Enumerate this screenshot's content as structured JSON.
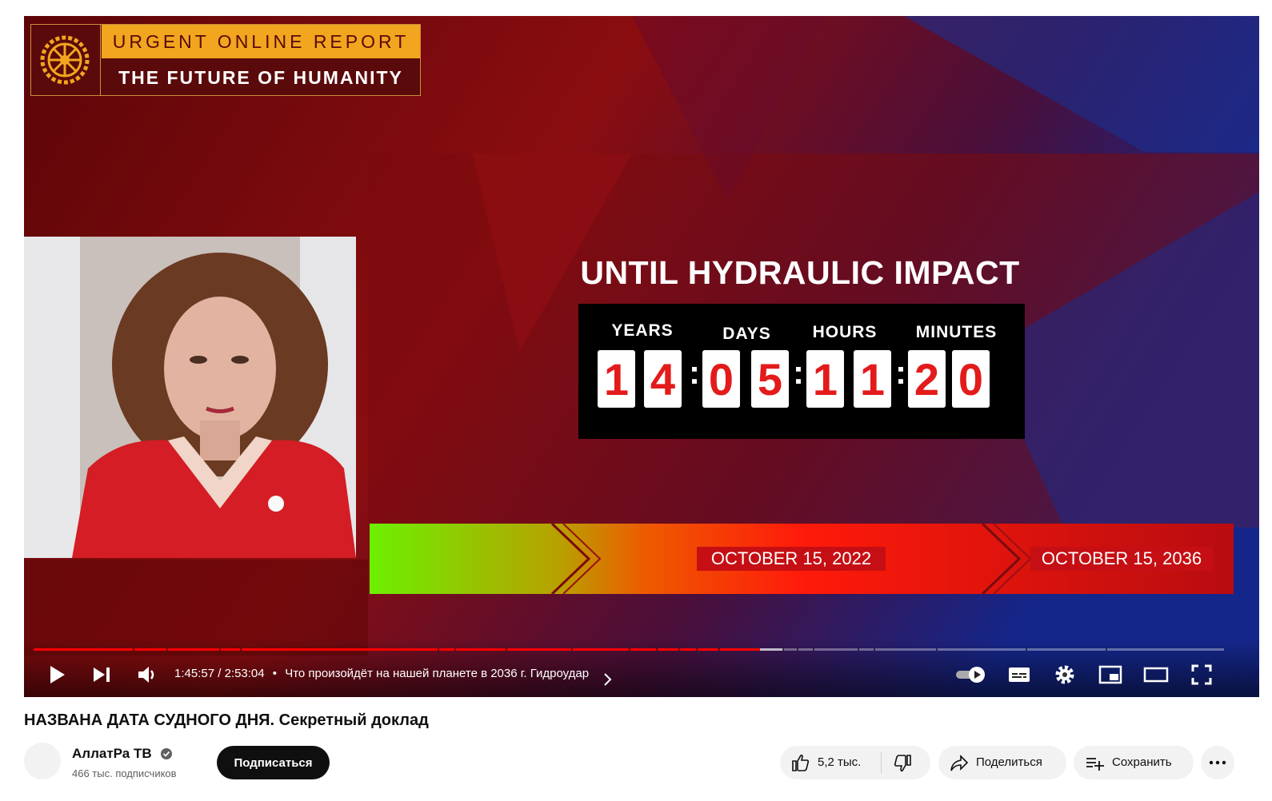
{
  "video": {
    "badge_top": "URGENT ONLINE REPORT",
    "badge_bottom": "THE FUTURE OF HUMANITY",
    "headline": "UNTIL HYDRAULIC IMPACT",
    "countdown": {
      "labels": {
        "years": "YEARS",
        "days": "DAYS",
        "hours": "HOURS",
        "minutes": "MINUTES"
      },
      "digits": [
        "1",
        "4",
        "0",
        "5",
        "1",
        "1",
        "2",
        "0"
      ]
    },
    "timeline": {
      "start_date": "OCTOBER 15, 2022",
      "end_date": "OCTOBER 15, 2036"
    },
    "colors": {
      "red_bg": "#6e0a0d",
      "blue_bg": "#1a2a7a",
      "accent": "#f2a51e",
      "digit": "#e31b1b"
    }
  },
  "player": {
    "current_time": "1:45:57",
    "separator": "/",
    "duration": "2:53:04",
    "dot": "•",
    "chapter_title": "Что произойдёт на нашей планете в 2036 г. Гидроудар",
    "progress": 0.61,
    "buffered": 0.63
  },
  "page": {
    "video_title": "НАЗВАНА ДАТА СУДНОГО ДНЯ. Секретный доклад",
    "channel_name": "АллатРа ТВ",
    "subscribers": "466 тыс. подписчиков",
    "subscribe_label": "Подписаться",
    "likes": "5,2 тыс.",
    "share_label": "Поделиться",
    "save_label": "Сохранить"
  },
  "icons": [
    "play-icon",
    "next-icon",
    "volume-icon",
    "chevron-right-icon",
    "autoplay-toggle",
    "subtitles-icon",
    "settings-gear-icon",
    "miniplayer-icon",
    "theater-mode-icon",
    "fullscreen-icon",
    "verified-icon",
    "thumbs-up-icon",
    "thumbs-down-icon",
    "share-arrow-icon",
    "save-playlist-icon",
    "more-dots-icon"
  ]
}
